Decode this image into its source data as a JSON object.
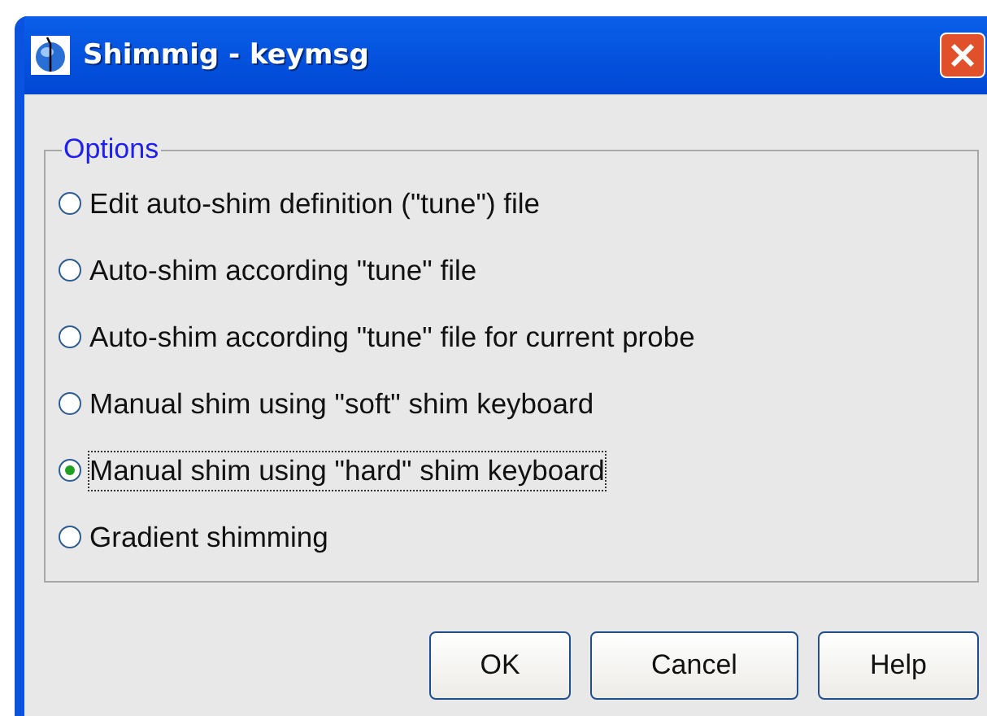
{
  "window": {
    "title": "Shimmig - keymsg"
  },
  "options": {
    "legend": "Options",
    "items": [
      {
        "label": "Edit auto-shim definition (\"tune\") file",
        "selected": false
      },
      {
        "label": "Auto-shim according \"tune\" file",
        "selected": false
      },
      {
        "label": "Auto-shim according \"tune\" file for current probe",
        "selected": false
      },
      {
        "label": "Manual shim using \"soft\" shim keyboard",
        "selected": false
      },
      {
        "label": "Manual shim using \"hard\" shim keyboard",
        "selected": true
      },
      {
        "label": "Gradient shimming",
        "selected": false
      }
    ]
  },
  "buttons": [
    "OK",
    "Cancel",
    "Help"
  ]
}
